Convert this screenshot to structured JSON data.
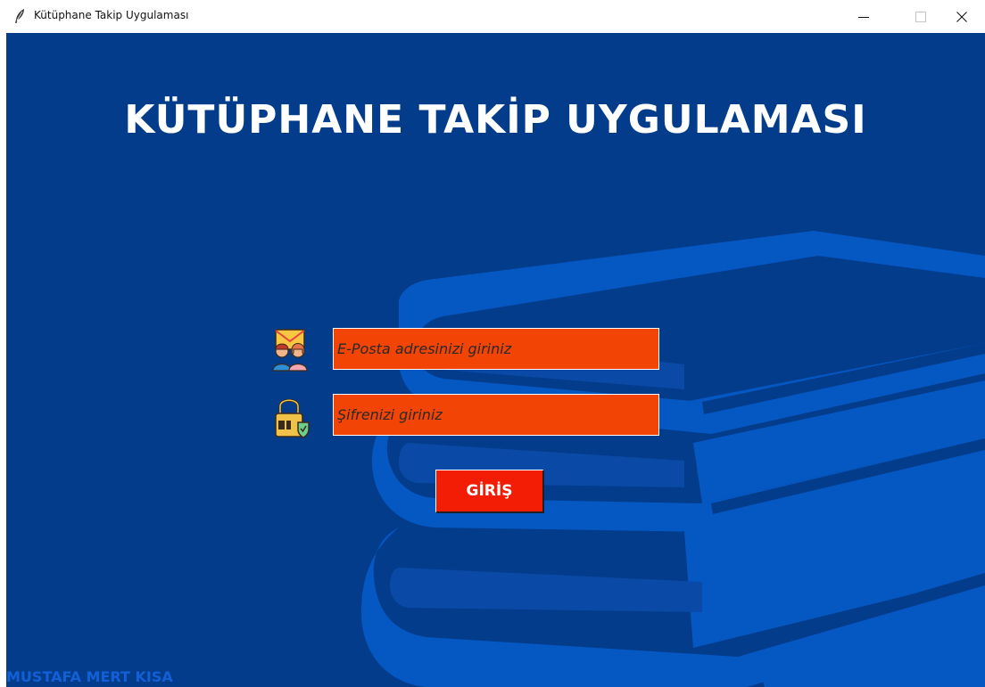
{
  "window": {
    "title": "Kütüphane Takip Uygulaması",
    "icon": "feather-icon",
    "controls": {
      "minimize_icon": "minimize-icon",
      "maximize_icon": "maximize-icon",
      "close_icon": "close-icon"
    }
  },
  "main": {
    "heading": "KÜTÜPHANE TAKİP UYGULAMASI",
    "email": {
      "icon": "email-users-icon",
      "value": "E-Posta adresinizi giriniz"
    },
    "password": {
      "icon": "padlock-shield-icon",
      "value": "Şifrenizi giriniz"
    },
    "login_button": "GİRİŞ",
    "credit": "MUSTAFA MERT KISA"
  },
  "colors": {
    "background": "#043c8c",
    "books_illustration": "#0557c2",
    "input_fill": "#f24405",
    "button_fill": "#f31d06",
    "heading_text": "#ffffff",
    "credit_text": "#1260d6"
  }
}
